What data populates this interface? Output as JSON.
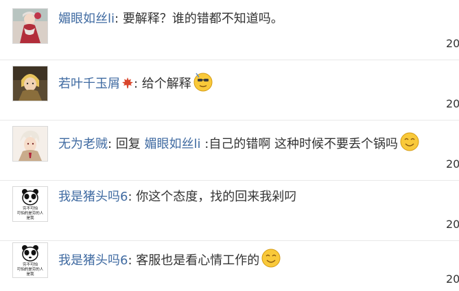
{
  "comments": [
    {
      "username": "媚眼如丝li",
      "separator": ": ",
      "text": "要解释？谁的错都不知道吗。",
      "timestamp": "20",
      "avatar": "doll-avatar"
    },
    {
      "username": "若叶千玉屑",
      "separator": ": ",
      "text": "给个解释",
      "timestamp": "20",
      "avatar": "warrior-avatar",
      "badge_icon": "maple-leaf-icon",
      "emoji": "cool-sunglasses-emoji"
    },
    {
      "username": "无为老贼",
      "separator": ": ",
      "reply_prefix": "回复",
      "reply_to": "媚眼如丝li",
      "text": " :自己的错啊 这种时候不要丢个锅吗",
      "timestamp": "20",
      "avatar": "anime-avatar",
      "emoji": "smile-emoji"
    },
    {
      "username": "我是猪头吗6",
      "separator": ": ",
      "text": "你这个态度，找的回来我剁叼",
      "timestamp": "20",
      "avatar": "panda-meme-avatar",
      "avatar_caption_line1": "穷不可怕",
      "avatar_caption_line2": "可怕的是穷的人",
      "avatar_caption_line3": "是我"
    },
    {
      "username": "我是猪头吗6",
      "separator": ": ",
      "text": "客服也是看心情工作的",
      "timestamp": "20",
      "avatar": "panda-meme-avatar",
      "avatar_caption_line1": "穷不可怕",
      "avatar_caption_line2": "可怕的是穷的人",
      "avatar_caption_line3": "是我",
      "emoji": "smile-emoji"
    }
  ],
  "colors": {
    "username": "#3f6aa1",
    "text": "#333333",
    "emoji_face": "#f9c93a"
  }
}
